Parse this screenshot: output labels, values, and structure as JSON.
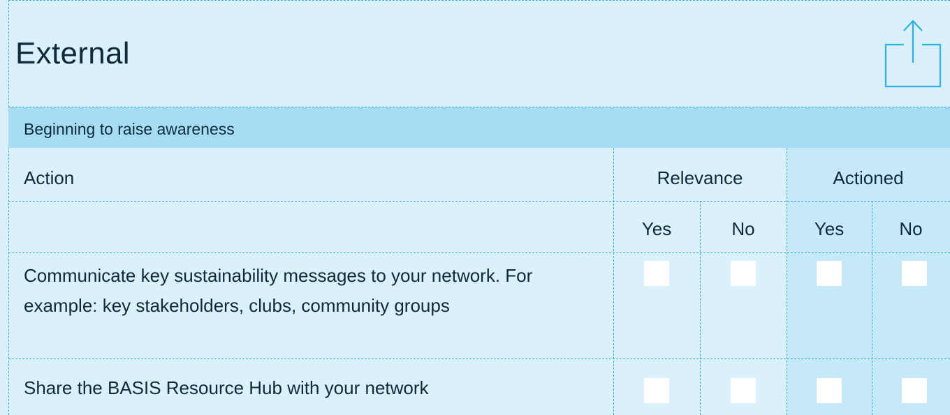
{
  "header": {
    "title": "External",
    "share_icon": "share-upload-icon"
  },
  "section": {
    "title": "Beginning to raise awareness"
  },
  "table": {
    "col_action": "Action",
    "col_relevance": "Relevance",
    "col_actioned": "Actioned",
    "sub_relevance_yes": "Yes",
    "sub_relevance_no": "No",
    "sub_actioned_yes": "Yes",
    "sub_actioned_no": "No",
    "rows": [
      {
        "action": "Communicate key sustainability messages to your network. For example: key stakeholders, clubs, community groups",
        "relevance_yes": false,
        "relevance_no": false,
        "actioned_yes": false,
        "actioned_no": false
      },
      {
        "action": "Share the BASIS Resource Hub with your network",
        "relevance_yes": false,
        "relevance_no": false,
        "actioned_yes": false,
        "actioned_no": false
      }
    ]
  },
  "colors": {
    "page_bg": "#daf1fb",
    "section_band": "#a7ddf4",
    "actioned_bg": "#c6e9f8",
    "dash": "#3aa8d8",
    "icon": "#2fb0e0"
  }
}
